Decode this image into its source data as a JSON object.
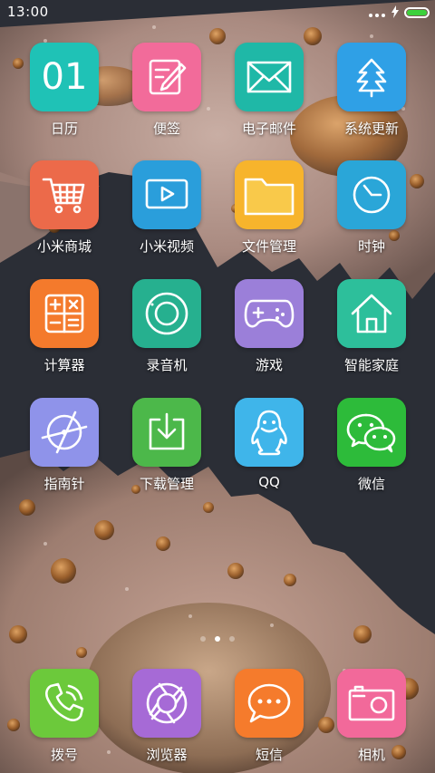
{
  "status_bar": {
    "time": "13:00",
    "battery_level": 1.0
  },
  "colors": {
    "calendar": "#1fc2b6",
    "notes": "#f26b9a",
    "email": "#1fb8a7",
    "update": "#2fa0e6",
    "mall": "#ec6a4a",
    "video": "#2a9edb",
    "files": "#f7b42c",
    "clock": "#2aa6d8",
    "calculator": "#f47a2c",
    "recorder": "#26b08f",
    "games": "#9b7fd9",
    "smarthome": "#2dbf9b",
    "compass": "#8f93ea",
    "download": "#4cb84a",
    "qq": "#3fb5ea",
    "wechat": "#2dbb3a",
    "phone": "#6cc93b",
    "browser": "#a66ad6",
    "sms": "#f57b2c",
    "camera": "#f2699a"
  },
  "apps": [
    {
      "label": "日历",
      "icon": "calendar-icon",
      "text": "01"
    },
    {
      "label": "便签",
      "icon": "notes-icon"
    },
    {
      "label": "电子邮件",
      "icon": "email-icon"
    },
    {
      "label": "系统更新",
      "icon": "system-update-icon"
    },
    {
      "label": "小米商城",
      "icon": "shopping-cart-icon"
    },
    {
      "label": "小米视频",
      "icon": "video-play-icon"
    },
    {
      "label": "文件管理",
      "icon": "folder-icon"
    },
    {
      "label": "时钟",
      "icon": "clock-icon"
    },
    {
      "label": "计算器",
      "icon": "calculator-icon"
    },
    {
      "label": "录音机",
      "icon": "recorder-icon"
    },
    {
      "label": "游戏",
      "icon": "gamepad-icon"
    },
    {
      "label": "智能家庭",
      "icon": "home-icon"
    },
    {
      "label": "指南针",
      "icon": "compass-icon"
    },
    {
      "label": "下载管理",
      "icon": "download-icon"
    },
    {
      "label": "QQ",
      "icon": "qq-penguin-icon"
    },
    {
      "label": "微信",
      "icon": "wechat-icon"
    }
  ],
  "dock": [
    {
      "label": "拨号",
      "icon": "phone-icon"
    },
    {
      "label": "浏览器",
      "icon": "browser-icon"
    },
    {
      "label": "短信",
      "icon": "sms-icon"
    },
    {
      "label": "相机",
      "icon": "camera-icon"
    }
  ],
  "pages": {
    "count": 3,
    "current": 2
  }
}
